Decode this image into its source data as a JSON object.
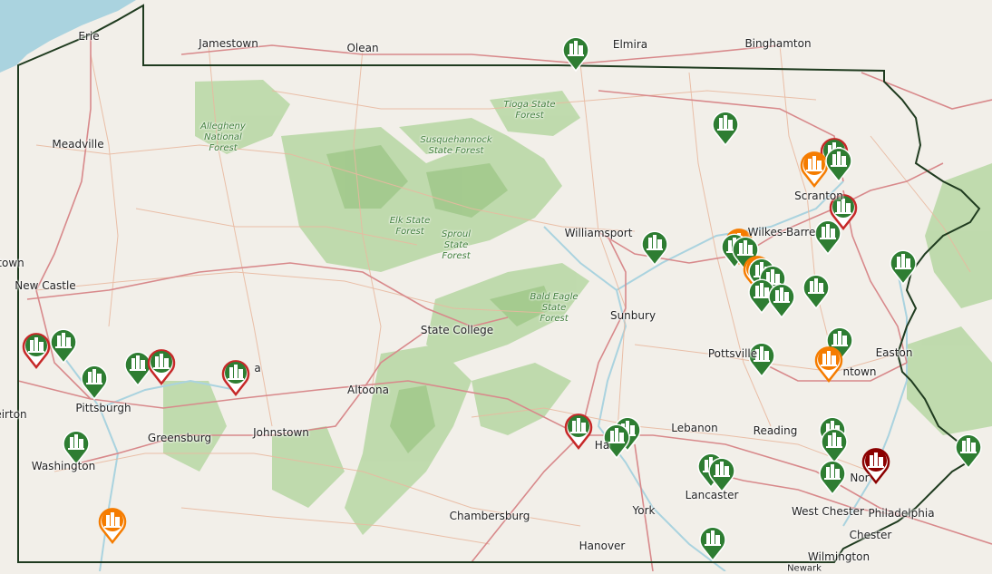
{
  "colors": {
    "land": "#f2efe9",
    "water": "#aad3df",
    "forest": "#a9cf94",
    "state_border": "#1f3b1f",
    "road_major": "#d98a8a",
    "road_minor": "#e8b9a6",
    "marker_green": "#2e7d32",
    "marker_red": "#c62828",
    "marker_orange": "#f57c00",
    "marker_darkred": "#8b0000"
  },
  "labels": {
    "cities": {
      "erie": "Erie",
      "jamestown": "Jamestown",
      "olean": "Olean",
      "elmira": "Elmira",
      "binghamton": "Binghamton",
      "meadville": "Meadville",
      "scranton": "Scranton",
      "wilkes_barre": "Wilkes-Barre",
      "williamsport": "Williamsport",
      "new_castle": "New Castle",
      "youngstown": "town",
      "state_college": "State College",
      "sunbury": "Sunbury",
      "pottsville": "Pottsville",
      "easton": "Easton",
      "allentown": "ntown",
      "altoona": "Altoona",
      "pittsburgh": "Pittsburgh",
      "greensburg": "Greensburg",
      "johnstown": "Johnstown",
      "indiana": "a",
      "weirton": "eirton",
      "washington": "Washington",
      "harrisburg": "Ha",
      "lebanon": "Lebanon",
      "reading": "Reading",
      "norristown": "Nor",
      "philadelphia": "Philadelphia",
      "west_chester": "West Chester",
      "chester": "Chester",
      "lancaster": "Lancaster",
      "york": "York",
      "chambersburg": "Chambersburg",
      "hanover": "Hanover",
      "wilmington": "Wilmington",
      "newark": "Newark"
    },
    "forests": {
      "allegheny": "Allegheny National Forest",
      "tioga": "Tioga State Forest",
      "susquehannock": "Susquehannock State Forest",
      "elk": "Elk State Forest",
      "sproul": "Sproul State Forest",
      "bald_eagle": "Bald Eagle State Forest"
    }
  },
  "markers": {
    "icon": "building-marker-icon",
    "note": "facility markers"
  }
}
